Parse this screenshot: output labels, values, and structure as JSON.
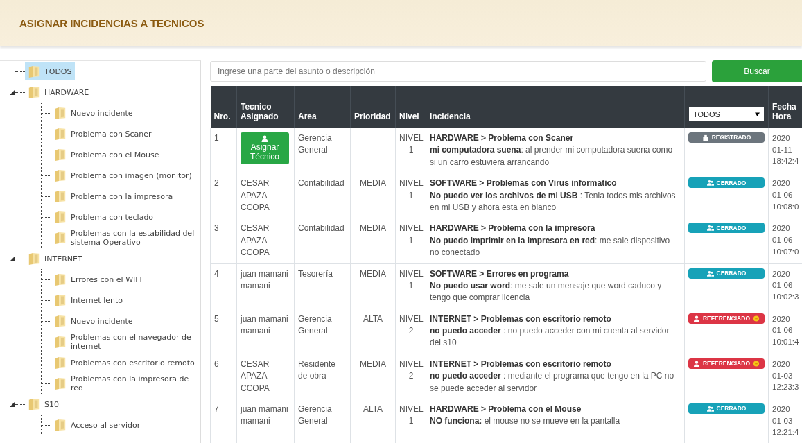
{
  "page_title": "ASIGNAR INCIDENCIAS A TECNICOS",
  "tree": [
    {
      "label": "TODOS",
      "selected": true
    },
    {
      "label": "HARDWARE",
      "selected": false,
      "children": [
        {
          "label": "Nuevo incidente",
          "selected": false
        },
        {
          "label": "Problema con Scaner",
          "selected": false
        },
        {
          "label": "Problema con el Mouse",
          "selected": false
        },
        {
          "label": "Problema con imagen (monitor)",
          "selected": false
        },
        {
          "label": "Problema con la impresora",
          "selected": false
        },
        {
          "label": "Problema con teclado",
          "selected": false
        },
        {
          "label": "Problemas con la estabilidad del sistema Operativo",
          "selected": false
        }
      ]
    },
    {
      "label": "INTERNET",
      "selected": false,
      "children": [
        {
          "label": "Errores con el WIFI",
          "selected": false
        },
        {
          "label": "Internet lento",
          "selected": false
        },
        {
          "label": "Nuevo incidente",
          "selected": false
        },
        {
          "label": "Problemas con el navegador de internet",
          "selected": false
        },
        {
          "label": "Problemas con escritorio remoto",
          "selected": false
        },
        {
          "label": "Problemas con la impresora de red",
          "selected": false
        }
      ]
    },
    {
      "label": "S10",
      "selected": false,
      "children": [
        {
          "label": "Acceso al servidor",
          "selected": false
        }
      ]
    }
  ],
  "search": {
    "placeholder": "Ingrese una parte del asunto o descripción",
    "button": "Buscar"
  },
  "table": {
    "columns": [
      "Nro.",
      "Tecnico Asignado",
      "Area",
      "Prioridad",
      "Nivel",
      "Incidencia"
    ],
    "status_filter": "TODOS",
    "date_column": [
      "Fecha",
      "Hora"
    ],
    "rows": [
      {
        "nro": "1",
        "tecnico": {
          "kind": "button",
          "label": "Asignar Técnico"
        },
        "area": "Gerencia General",
        "nivel": "NIVEL 1",
        "title": "HARDWARE > Problema con Scaner",
        "description": "**mi computadora suena**: al prender mi computadora suena como si un carro estuviera arrancando",
        "status": {
          "kind": "registrado",
          "label": "REGISTRADO"
        },
        "date": [
          "2020-",
          "01-11",
          "18:42:4"
        ]
      },
      {
        "nro": "2",
        "tecnico": {
          "kind": "text",
          "label": "CESAR APAZA CCOPA"
        },
        "area": "Contabilidad",
        "prioridad": "MEDIA",
        "nivel": "NIVEL 1",
        "title": "SOFTWARE > Problemas con Virus informatico",
        "description": "**No puedo ver los archivos de mi USB** : Tenia todos mis archivos en mi USB y ahora esta en blanco",
        "status": {
          "kind": "cerrado",
          "label": "CERRADO"
        },
        "date": [
          "2020-",
          "01-06",
          "10:08:0"
        ]
      },
      {
        "nro": "3",
        "tecnico": {
          "kind": "text",
          "label": "CESAR APAZA CCOPA"
        },
        "area": "Contabilidad",
        "prioridad": "MEDIA",
        "nivel": "NIVEL 1",
        "title": "HARDWARE > Problema con la impresora",
        "description": "**No puedo imprimir en la impresora en red**: me sale dispositivo no conectado",
        "status": {
          "kind": "cerrado",
          "label": "CERRADO"
        },
        "date": [
          "2020-",
          "01-06",
          "10:07:0"
        ]
      },
      {
        "nro": "4",
        "tecnico": {
          "kind": "text",
          "label": "juan mamani mamani"
        },
        "area": "Tesorería",
        "prioridad": "MEDIA",
        "nivel": "NIVEL 1",
        "title": "SOFTWARE > Errores en programa",
        "description": "**No puedo usar word**: me sale un mensaje que word caduco y tengo que comprar licencia",
        "status": {
          "kind": "cerrado",
          "label": "CERRADO"
        },
        "date": [
          "2020-",
          "01-06",
          "10:02:3"
        ]
      },
      {
        "nro": "5",
        "tecnico": {
          "kind": "text",
          "label": "juan mamani mamani"
        },
        "area": "Gerencia General",
        "prioridad": "ALTA",
        "nivel": "NIVEL 2",
        "title": "INTERNET > Problemas con escritorio remoto",
        "description": "**no puedo acceder** : no puedo acceder con mi cuenta al servidor del s10",
        "status": {
          "kind": "referenciado",
          "label": "REFERENCIADO"
        },
        "date": [
          "2020-",
          "01-06",
          "10:01:4"
        ]
      },
      {
        "nro": "6",
        "tecnico": {
          "kind": "text",
          "label": "CESAR APAZA CCOPA"
        },
        "area": "Residente de obra",
        "prioridad": "MEDIA",
        "nivel": "NIVEL 2",
        "title": "INTERNET > Problemas con escritorio remoto",
        "description": "**no puedo acceder** : mediante el programa que tengo en la PC no se puede acceder al servidor",
        "status": {
          "kind": "referenciado",
          "label": "REFERENCIADO"
        },
        "date": [
          "2020-",
          "01-03",
          "12:23:3"
        ]
      },
      {
        "nro": "7",
        "tecnico": {
          "kind": "text",
          "label": "juan mamani mamani"
        },
        "area": "Gerencia General",
        "prioridad": "ALTA",
        "nivel": "NIVEL 1",
        "title": "HARDWARE > Problema con el Mouse",
        "description": "**NO funciona:** el mouse no se mueve en la pantalla",
        "status": {
          "kind": "cerrado",
          "label": "CERRADO"
        },
        "date": [
          "2020-",
          "01-03",
          "12:21:4"
        ]
      }
    ]
  }
}
